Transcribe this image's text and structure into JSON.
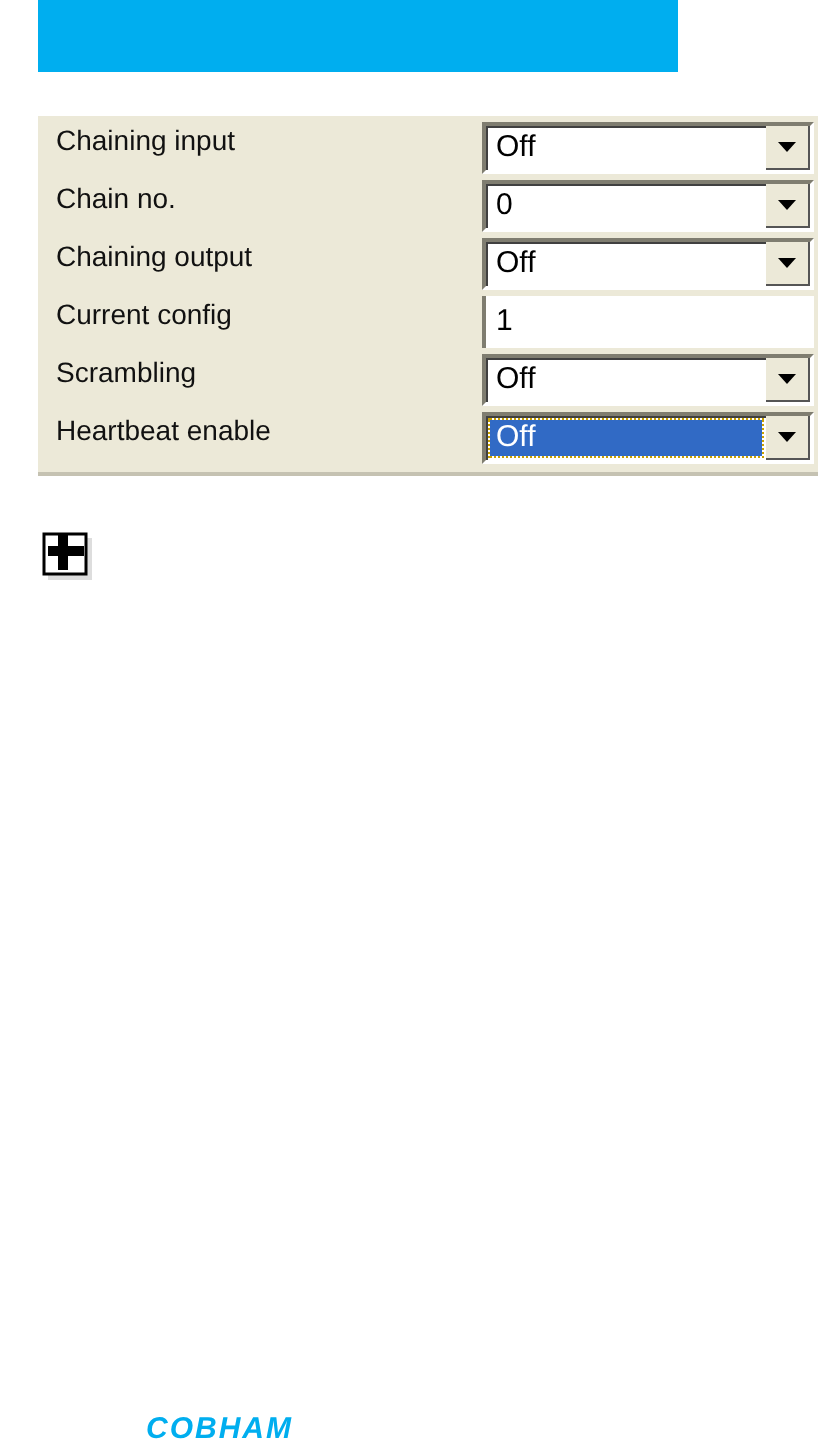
{
  "settings": [
    {
      "label": "Chaining input",
      "kind": "dropdown",
      "value": "Off",
      "selected": false
    },
    {
      "label": "Chain no.",
      "kind": "dropdown",
      "value": "0",
      "selected": false
    },
    {
      "label": "Chaining output",
      "kind": "dropdown",
      "value": "Off",
      "selected": false
    },
    {
      "label": "Current config",
      "kind": "text",
      "value": "1",
      "selected": false
    },
    {
      "label": "Scrambling",
      "kind": "dropdown",
      "value": "Off",
      "selected": false
    },
    {
      "label": "Heartbeat enable",
      "kind": "dropdown",
      "value": "Off",
      "selected": true
    }
  ],
  "footer": {
    "logo": "COBHAM"
  }
}
